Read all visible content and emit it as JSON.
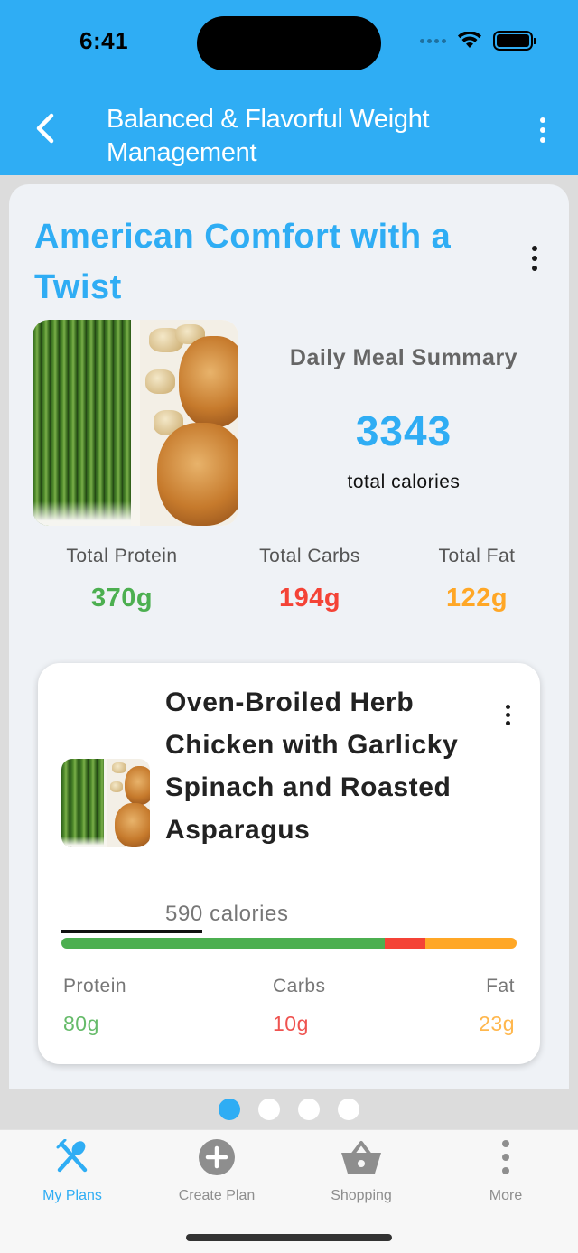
{
  "status_bar": {
    "time": "6:41"
  },
  "header": {
    "title": "Balanced & Flavorful Weight Management"
  },
  "plan": {
    "title": "American Comfort with a Twist",
    "summary_label": "Daily Meal Summary",
    "total_calories": "3343",
    "total_calories_label": "total calories",
    "macros": {
      "protein": {
        "label": "Total Protein",
        "value": "370g",
        "color": "#4caf50"
      },
      "carbs": {
        "label": "Total Carbs",
        "value": "194g",
        "color": "#f44336"
      },
      "fat": {
        "label": "Total Fat",
        "value": "122g",
        "color": "#ffa726"
      }
    }
  },
  "meal": {
    "title": "Oven-Broiled Herb Chicken with Garlicky Spinach and Roasted Asparagus",
    "calories": "590 calories",
    "macro_bar": [
      {
        "name": "protein",
        "fraction": 0.71,
        "color": "#4caf50"
      },
      {
        "name": "carbs",
        "fraction": 0.09,
        "color": "#f44336"
      },
      {
        "name": "fat",
        "fraction": 0.2,
        "color": "#ffa726"
      }
    ],
    "macros": {
      "protein": {
        "label": "Protein",
        "value": "80g",
        "color": "#66bb6a"
      },
      "carbs": {
        "label": "Carbs",
        "value": "10g",
        "color": "#ef5350"
      },
      "fat": {
        "label": "Fat",
        "value": "23g",
        "color": "#ffb74d"
      }
    }
  },
  "pagination": {
    "count": 4,
    "active": 0
  },
  "tabbar": {
    "tabs": [
      {
        "label": "My Plans",
        "icon": "utensils-icon",
        "active": true
      },
      {
        "label": "Create Plan",
        "icon": "plus-circle-icon",
        "active": false
      },
      {
        "label": "Shopping",
        "icon": "basket-icon",
        "active": false
      },
      {
        "label": "More",
        "icon": "more-vertical-icon",
        "active": false
      }
    ]
  },
  "colors": {
    "accent": "#2fadf4"
  }
}
